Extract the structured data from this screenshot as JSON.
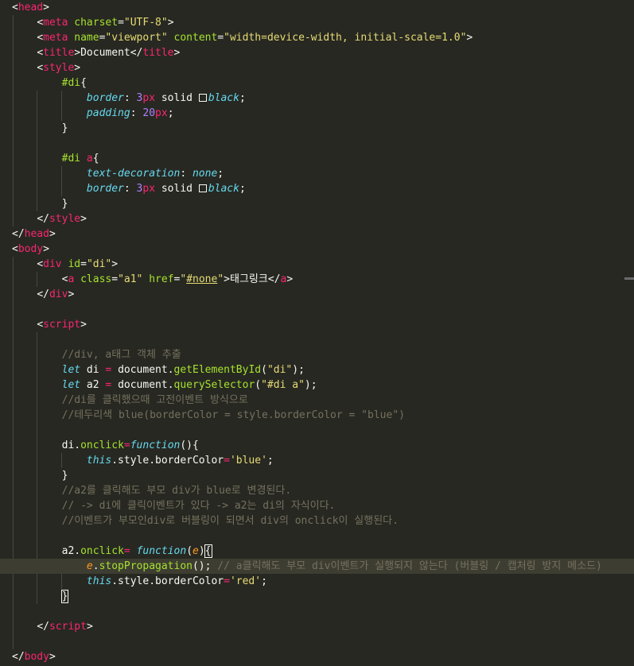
{
  "editor": {
    "lines": [
      [
        {
          "t": "<",
          "c": "t-plain"
        },
        {
          "t": "head",
          "c": "t-tag"
        },
        {
          "t": ">",
          "c": "t-plain"
        }
      ],
      [
        {
          "t": "    ",
          "c": "t-plain"
        },
        {
          "t": "<",
          "c": "t-plain"
        },
        {
          "t": "meta",
          "c": "t-tag"
        },
        {
          "t": " charset",
          "c": "t-attr"
        },
        {
          "t": "=",
          "c": "t-plain"
        },
        {
          "t": "\"UTF-8\"",
          "c": "t-str"
        },
        {
          "t": ">",
          "c": "t-plain"
        }
      ],
      [
        {
          "t": "    ",
          "c": "t-plain"
        },
        {
          "t": "<",
          "c": "t-plain"
        },
        {
          "t": "meta",
          "c": "t-tag"
        },
        {
          "t": " name",
          "c": "t-attr"
        },
        {
          "t": "=",
          "c": "t-plain"
        },
        {
          "t": "\"viewport\"",
          "c": "t-str"
        },
        {
          "t": " content",
          "c": "t-attr"
        },
        {
          "t": "=",
          "c": "t-plain"
        },
        {
          "t": "\"width=device-width, initial-scale=1.0\"",
          "c": "t-str"
        },
        {
          "t": ">",
          "c": "t-plain"
        }
      ],
      [
        {
          "t": "    ",
          "c": "t-plain"
        },
        {
          "t": "<",
          "c": "t-plain"
        },
        {
          "t": "title",
          "c": "t-tag"
        },
        {
          "t": ">Document</",
          "c": "t-plain"
        },
        {
          "t": "title",
          "c": "t-tag"
        },
        {
          "t": ">",
          "c": "t-plain"
        }
      ],
      [
        {
          "t": "    ",
          "c": "t-plain"
        },
        {
          "t": "<",
          "c": "t-plain"
        },
        {
          "t": "style",
          "c": "t-tag"
        },
        {
          "t": ">",
          "c": "t-plain"
        }
      ],
      [
        {
          "t": "        ",
          "c": "t-plain"
        },
        {
          "t": "#di",
          "c": "t-attr"
        },
        {
          "t": "{",
          "c": "t-plain"
        }
      ],
      [
        {
          "t": "            ",
          "c": "t-plain"
        },
        {
          "t": "border",
          "c": "t-prop"
        },
        {
          "t": ": ",
          "c": "t-plain"
        },
        {
          "t": "3",
          "c": "t-num"
        },
        {
          "t": "px",
          "c": "t-kw2"
        },
        {
          "t": " solid ",
          "c": "t-plain"
        },
        {
          "t": "",
          "c": "swatch"
        },
        {
          "t": "black",
          "c": "t-kw"
        },
        {
          "t": ";",
          "c": "t-plain"
        }
      ],
      [
        {
          "t": "            ",
          "c": "t-plain"
        },
        {
          "t": "padding",
          "c": "t-prop"
        },
        {
          "t": ": ",
          "c": "t-plain"
        },
        {
          "t": "20",
          "c": "t-num"
        },
        {
          "t": "px",
          "c": "t-kw2"
        },
        {
          "t": ";",
          "c": "t-plain"
        }
      ],
      [
        {
          "t": "        ",
          "c": "t-plain"
        },
        {
          "t": "}",
          "c": "t-plain"
        }
      ],
      [
        {
          "t": "",
          "c": "t-plain"
        }
      ],
      [
        {
          "t": "        ",
          "c": "t-plain"
        },
        {
          "t": "#di",
          "c": "t-attr"
        },
        {
          "t": " a",
          "c": "t-tag"
        },
        {
          "t": "{",
          "c": "t-plain"
        }
      ],
      [
        {
          "t": "            ",
          "c": "t-plain"
        },
        {
          "t": "text-decoration",
          "c": "t-prop"
        },
        {
          "t": ": ",
          "c": "t-plain"
        },
        {
          "t": "none",
          "c": "t-kw"
        },
        {
          "t": ";",
          "c": "t-plain"
        }
      ],
      [
        {
          "t": "            ",
          "c": "t-plain"
        },
        {
          "t": "border",
          "c": "t-prop"
        },
        {
          "t": ": ",
          "c": "t-plain"
        },
        {
          "t": "3",
          "c": "t-num"
        },
        {
          "t": "px",
          "c": "t-kw2"
        },
        {
          "t": " solid ",
          "c": "t-plain"
        },
        {
          "t": "",
          "c": "swatch"
        },
        {
          "t": "black",
          "c": "t-kw"
        },
        {
          "t": ";",
          "c": "t-plain"
        }
      ],
      [
        {
          "t": "        ",
          "c": "t-plain"
        },
        {
          "t": "}",
          "c": "t-plain"
        }
      ],
      [
        {
          "t": "    ",
          "c": "t-plain"
        },
        {
          "t": "</",
          "c": "t-plain"
        },
        {
          "t": "style",
          "c": "t-tag"
        },
        {
          "t": ">",
          "c": "t-plain"
        }
      ],
      [
        {
          "t": "</",
          "c": "t-plain"
        },
        {
          "t": "head",
          "c": "t-tag"
        },
        {
          "t": ">",
          "c": "t-plain"
        }
      ],
      [
        {
          "t": "<",
          "c": "t-plain"
        },
        {
          "t": "body",
          "c": "t-tag"
        },
        {
          "t": ">",
          "c": "t-plain"
        }
      ],
      [
        {
          "t": "    ",
          "c": "t-plain"
        },
        {
          "t": "<",
          "c": "t-plain"
        },
        {
          "t": "div",
          "c": "t-tag"
        },
        {
          "t": " id",
          "c": "t-attr"
        },
        {
          "t": "=",
          "c": "t-plain"
        },
        {
          "t": "\"di\"",
          "c": "t-str"
        },
        {
          "t": ">",
          "c": "t-plain"
        }
      ],
      [
        {
          "t": "        ",
          "c": "t-plain"
        },
        {
          "t": "<",
          "c": "t-plain"
        },
        {
          "t": "a",
          "c": "t-tag"
        },
        {
          "t": " class",
          "c": "t-attr"
        },
        {
          "t": "=",
          "c": "t-plain"
        },
        {
          "t": "\"a1\"",
          "c": "t-str"
        },
        {
          "t": " href",
          "c": "t-attr"
        },
        {
          "t": "=",
          "c": "t-plain"
        },
        {
          "t": "\"",
          "c": "t-str"
        },
        {
          "t": "#none",
          "c": "t-str-u"
        },
        {
          "t": "\"",
          "c": "t-str"
        },
        {
          "t": ">태그링크</",
          "c": "t-plain"
        },
        {
          "t": "a",
          "c": "t-tag"
        },
        {
          "t": ">",
          "c": "t-plain"
        }
      ],
      [
        {
          "t": "    ",
          "c": "t-plain"
        },
        {
          "t": "</",
          "c": "t-plain"
        },
        {
          "t": "div",
          "c": "t-tag"
        },
        {
          "t": ">",
          "c": "t-plain"
        }
      ],
      [
        {
          "t": "",
          "c": "t-plain"
        }
      ],
      [
        {
          "t": "    ",
          "c": "t-plain"
        },
        {
          "t": "<",
          "c": "t-plain"
        },
        {
          "t": "script",
          "c": "t-tag"
        },
        {
          "t": ">",
          "c": "t-plain"
        }
      ],
      [
        {
          "t": "",
          "c": "t-plain"
        }
      ],
      [
        {
          "t": "        ",
          "c": "t-plain"
        },
        {
          "t": "//div, a태그 객체 추출",
          "c": "t-cmt"
        }
      ],
      [
        {
          "t": "        ",
          "c": "t-plain"
        },
        {
          "t": "let",
          "c": "t-kw"
        },
        {
          "t": " di ",
          "c": "t-plain"
        },
        {
          "t": "=",
          "c": "t-kw2"
        },
        {
          "t": " document.",
          "c": "t-plain"
        },
        {
          "t": "getElementById",
          "c": "t-fn"
        },
        {
          "t": "(",
          "c": "t-plain"
        },
        {
          "t": "\"di\"",
          "c": "t-str"
        },
        {
          "t": ");",
          "c": "t-plain"
        }
      ],
      [
        {
          "t": "        ",
          "c": "t-plain"
        },
        {
          "t": "let",
          "c": "t-kw"
        },
        {
          "t": " a2 ",
          "c": "t-plain"
        },
        {
          "t": "=",
          "c": "t-kw2"
        },
        {
          "t": " document.",
          "c": "t-plain"
        },
        {
          "t": "querySelector",
          "c": "t-fn"
        },
        {
          "t": "(",
          "c": "t-plain"
        },
        {
          "t": "\"#di a\"",
          "c": "t-str"
        },
        {
          "t": ");",
          "c": "t-plain"
        }
      ],
      [
        {
          "t": "        ",
          "c": "t-plain"
        },
        {
          "t": "//di를 클릭했으때 고전이벤트 방식으로",
          "c": "t-cmt"
        }
      ],
      [
        {
          "t": "        ",
          "c": "t-plain"
        },
        {
          "t": "//테두리색 blue(borderColor = style.borderColor = \"blue\")",
          "c": "t-cmt"
        }
      ],
      [
        {
          "t": "",
          "c": "t-plain"
        }
      ],
      [
        {
          "t": "        ",
          "c": "t-plain"
        },
        {
          "t": "di.",
          "c": "t-plain"
        },
        {
          "t": "onclick",
          "c": "t-fn"
        },
        {
          "t": "=",
          "c": "t-kw2"
        },
        {
          "t": "function",
          "c": "t-kw"
        },
        {
          "t": "(){",
          "c": "t-plain"
        }
      ],
      [
        {
          "t": "            ",
          "c": "t-plain"
        },
        {
          "t": "this",
          "c": "t-this2"
        },
        {
          "t": ".style.borderColor",
          "c": "t-plain"
        },
        {
          "t": "=",
          "c": "t-kw2"
        },
        {
          "t": "'blue'",
          "c": "t-str"
        },
        {
          "t": ";",
          "c": "t-plain"
        }
      ],
      [
        {
          "t": "        ",
          "c": "t-plain"
        },
        {
          "t": "}",
          "c": "t-plain"
        }
      ],
      [
        {
          "t": "        ",
          "c": "t-plain"
        },
        {
          "t": "//a2를 클릭해도 부모 div가 blue로 변경된다.",
          "c": "t-cmt"
        }
      ],
      [
        {
          "t": "        ",
          "c": "t-plain"
        },
        {
          "t": "// -> di에 클릭이벤트가 있다 -> a2는 di의 자식이다.",
          "c": "t-cmt"
        }
      ],
      [
        {
          "t": "        ",
          "c": "t-plain"
        },
        {
          "t": "//이벤트가 부모인div로 버블링이 되면서 div의 onclick이 실행된다.",
          "c": "t-cmt"
        }
      ],
      [
        {
          "t": "",
          "c": "t-plain"
        }
      ],
      [
        {
          "t": "        ",
          "c": "t-plain"
        },
        {
          "t": "a2.",
          "c": "t-plain"
        },
        {
          "t": "onclick",
          "c": "t-fn"
        },
        {
          "t": "= ",
          "c": "t-kw2"
        },
        {
          "t": "function",
          "c": "t-kw"
        },
        {
          "t": "(",
          "c": "t-plain"
        },
        {
          "t": "e",
          "c": "t-param"
        },
        {
          "t": ")",
          "c": "t-plain"
        },
        {
          "t": "{",
          "c": "t-plain bracket-box"
        }
      ],
      [
        {
          "t": "            ",
          "c": "t-plain"
        },
        {
          "t": "e",
          "c": "t-this"
        },
        {
          "t": ".",
          "c": "t-plain"
        },
        {
          "t": "stopPropagation",
          "c": "t-fn"
        },
        {
          "t": "(); ",
          "c": "t-plain"
        },
        {
          "t": "// a클릭해도 부모 div이벤트가 실행되지 않는다 (버블링 / 캡처링 방지 메소드)",
          "c": "t-cmt"
        }
      ],
      [
        {
          "t": "            ",
          "c": "t-plain"
        },
        {
          "t": "this",
          "c": "t-this2"
        },
        {
          "t": ".style.borderColor",
          "c": "t-plain"
        },
        {
          "t": "=",
          "c": "t-kw2"
        },
        {
          "t": "'red'",
          "c": "t-str"
        },
        {
          "t": ";",
          "c": "t-plain"
        }
      ],
      [
        {
          "t": "        ",
          "c": "t-plain"
        },
        {
          "t": "}",
          "c": "t-plain bracket-box"
        }
      ],
      [
        {
          "t": "",
          "c": "t-plain"
        }
      ],
      [
        {
          "t": "    ",
          "c": "t-plain"
        },
        {
          "t": "</",
          "c": "t-plain"
        },
        {
          "t": "script",
          "c": "t-tag"
        },
        {
          "t": ">",
          "c": "t-plain"
        }
      ],
      [
        {
          "t": "",
          "c": "t-plain"
        }
      ],
      [
        {
          "t": "</",
          "c": "t-plain"
        },
        {
          "t": "body",
          "c": "t-tag"
        },
        {
          "t": ">",
          "c": "t-plain"
        }
      ]
    ],
    "current_line_index": 37
  },
  "colors": {
    "background": "#272822",
    "tag": "#f92672",
    "attribute": "#a6e22e",
    "string": "#e6db74",
    "number": "#ae81ff",
    "keyword": "#66d9ef",
    "comment": "#75715e",
    "current_line": "#3e3d32"
  }
}
